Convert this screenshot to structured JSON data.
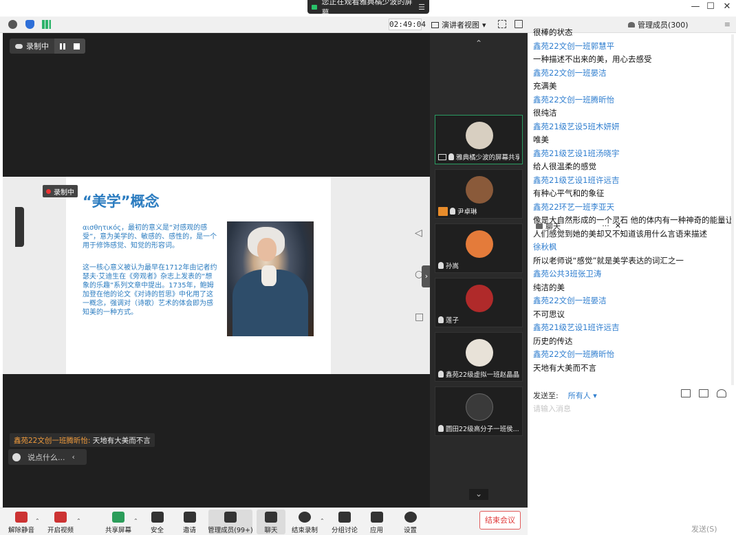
{
  "window": {
    "banner": "您正在观看雅典橘少波的屏幕",
    "minimize": "—",
    "maximize": "☐",
    "close": "✕"
  },
  "toolbar_top": {
    "timer": "02:49:04",
    "view_label": "演讲者视图",
    "view_caret": "▾"
  },
  "recording": {
    "label": "录制中"
  },
  "slide": {
    "rec_tag": "录制中",
    "title": "“美学”概念",
    "para1": "αισθητικός，最初的意义是“对感观的感受”，意为美学的、敏感的、感性的，是一个用于修饰感觉、知觉的形容词。",
    "para2": "这一核心意义被认为最早在1712年由记者约瑟夫·艾迪生在《旁观者》杂志上发表的“想象的乐趣”系列文章中提出。1735年，鲍姆加登在他的论文《对诗的哲思》中化用了这一概念，强调对（诗歌）艺术的体会即为感知美的一种方式。"
  },
  "overlay_chat": {
    "name": "鑫苑22文创一班腾昕怡:",
    "text": "天地有大美而不言",
    "say_placeholder": "说点什么...",
    "say_arrow": "‹"
  },
  "participants": {
    "up": "⌃",
    "down": "⌄",
    "tiles": [
      {
        "name": "雅典橘少波的屏幕共享",
        "color": "#d8cfc1"
      },
      {
        "name": "尹卓琳",
        "color": "#8a5a3a"
      },
      {
        "name": "孙嵩",
        "color": "#e47b3a"
      },
      {
        "name": "莲子",
        "color": "#b02a2a"
      },
      {
        "name": "鑫苑22级虚拟一班赵晶晶",
        "color": "#e8e2d8"
      },
      {
        "name": "圆田22级高分子一班侯...",
        "color": "#3a3a3a"
      }
    ]
  },
  "chat_panel": {
    "tab_chat": "聊天",
    "tab_dots": "···",
    "tab_close": "✕",
    "tab_members": "管理成员(300)",
    "menu": "≡",
    "messages": [
      {
        "kind": "text",
        "t": "很棒的状态"
      },
      {
        "kind": "name",
        "t": "鑫苑22文创一班郭慧平"
      },
      {
        "kind": "text",
        "t": "一种描述不出来的美，用心去感受"
      },
      {
        "kind": "name",
        "t": "鑫苑22文创一班晏洁"
      },
      {
        "kind": "text",
        "t": "充满美"
      },
      {
        "kind": "name",
        "t": "鑫苑22文创一班腾昕怡"
      },
      {
        "kind": "text",
        "t": "很纯洁"
      },
      {
        "kind": "name",
        "t": "鑫苑21级艺设5班木妍妍"
      },
      {
        "kind": "text",
        "t": "唯美"
      },
      {
        "kind": "name",
        "t": "鑫苑21级艺设1班汤晓宇"
      },
      {
        "kind": "text",
        "t": "给人很温柔的感觉"
      },
      {
        "kind": "name",
        "t": "鑫苑21级艺设1班许远吉"
      },
      {
        "kind": "text",
        "t": "有种心平气和的象征"
      },
      {
        "kind": "name",
        "t": "鑫苑22环艺一班李亚天"
      },
      {
        "kind": "text",
        "t": "像是大自然形成的一个灵石 他的体内有一种神奇的能量让"
      },
      {
        "kind": "text",
        "t": "人们感觉到她的美却又不知道该用什么言语来描述"
      },
      {
        "kind": "name",
        "t": "徐秋枫"
      },
      {
        "kind": "text",
        "t": "所以老师说“感觉”就是美学表达的词汇之一"
      },
      {
        "kind": "name",
        "t": "鑫苑公共3班张卫涛"
      },
      {
        "kind": "text",
        "t": "纯洁的美"
      },
      {
        "kind": "name",
        "t": "鑫苑22文创一班晏洁"
      },
      {
        "kind": "text",
        "t": "不可思议"
      },
      {
        "kind": "name",
        "t": "鑫苑21级艺设1班许远吉"
      },
      {
        "kind": "text",
        "t": "历史的传达"
      },
      {
        "kind": "name",
        "t": "鑫苑22文创一班腾昕怡"
      },
      {
        "kind": "text",
        "t": "天地有大美而不言"
      }
    ],
    "send_to_label": "发送至:",
    "send_to_value": "所有人 ▾",
    "input_placeholder": "请输入消息",
    "send_button": "发送(S)"
  },
  "bottom_toolbar": {
    "unmute": "解除静音",
    "start_video": "开启视频",
    "share_screen": "共享屏幕",
    "security": "安全",
    "invite": "邀请",
    "members": "管理成员(99+)",
    "chat": "聊天",
    "end_recording": "结束录制",
    "breakout": "分组讨论",
    "apps": "应用",
    "settings": "设置",
    "end_meeting": "结束会议",
    "caret": "⌃"
  }
}
